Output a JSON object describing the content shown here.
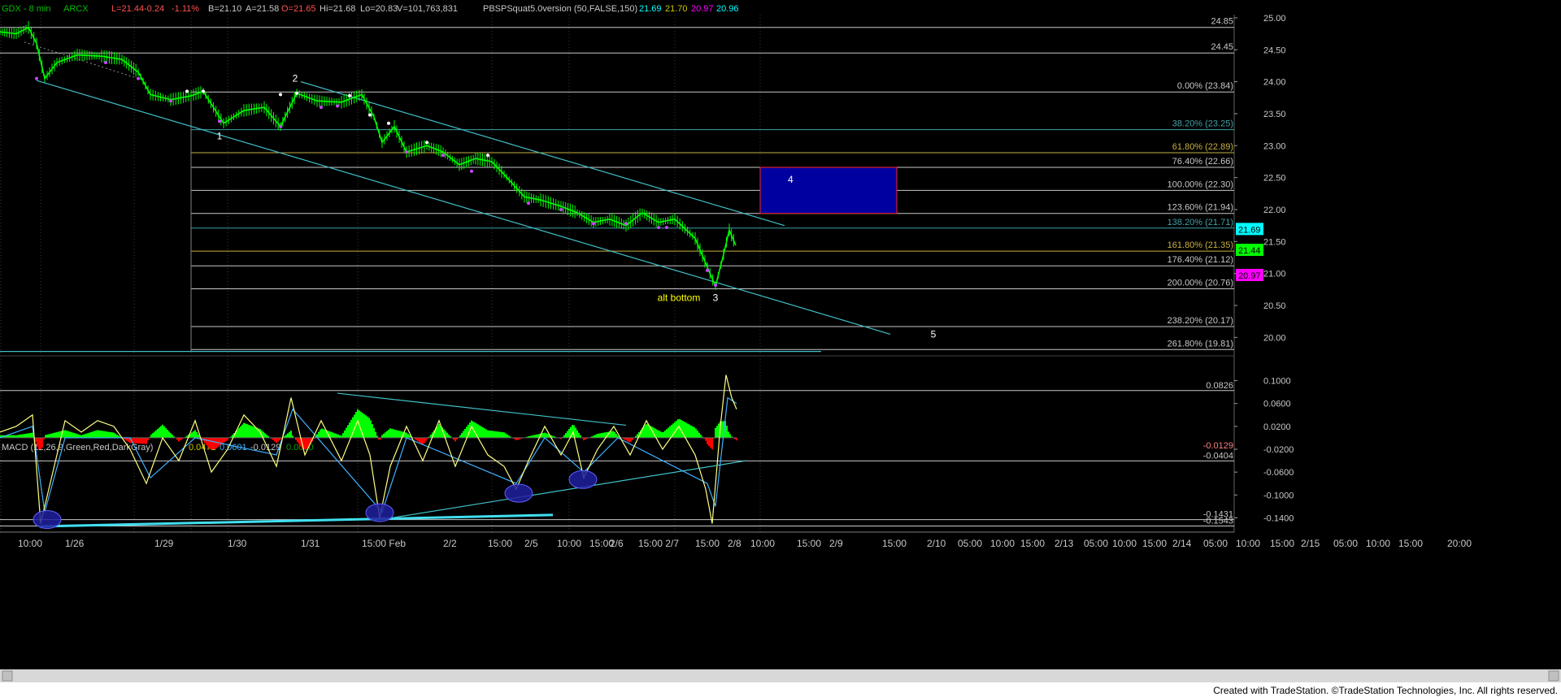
{
  "header": {
    "symbol": "GDX - 8 min",
    "exchange": "ARCX",
    "last": "L=21.44",
    "change": "-0.24",
    "change_pct": "-1.11%",
    "bid": "B=21.10",
    "ask": "A=21.58",
    "open": "O=21.65",
    "high": "Hi=21.68",
    "low": "Lo=20.83",
    "volume": "V=101,763,831",
    "indicator": "PBSPSquat5.0version (50,FALSE,150)",
    "ind_val_1": "21.69",
    "ind_val_2": "21.70",
    "ind_val_3": "20.97",
    "ind_val_4": "20.96"
  },
  "macd_header": {
    "label": "MACD (12,26,9,Green,Red,DarkGray)",
    "v1": "0.0472",
    "v2": "0.0601",
    "v3": "-0.0129",
    "v4": "0.0000"
  },
  "footer": "Created with TradeStation. ©TradeStation Technologies, Inc. All rights reserved.",
  "colors": {
    "background": "#000000",
    "price": "#00ff00",
    "pivot_dots": "#cc44ff",
    "fib_line": "#c8c8c8",
    "channel": "#40c0c8",
    "target_box": "#0000a0",
    "target_border": "#ff2020",
    "macd_hist_pos": "#00ff00",
    "macd_hist_neg": "#ff0000",
    "macd_line": "#ffff80",
    "signal_line": "#40b0ff",
    "ellipse": "#2020a0",
    "price_label_cyan": "#00ffff",
    "price_label_green": "#00ff00",
    "price_label_magenta": "#ff00ff"
  },
  "chart_data": [
    {
      "type": "line",
      "title": "GDX - 8 min",
      "ylim": [
        19.75,
        25.05
      ],
      "y_ticks": [
        "25.00",
        "24.50",
        "24.00",
        "23.50",
        "23.00",
        "22.50",
        "22.00",
        "21.50",
        "21.00",
        "20.50",
        "20.00"
      ],
      "x_tick_labels": [
        "10:00",
        "1/26",
        "1/29",
        "1/30",
        "1/31",
        "15:00 Feb",
        "2/2",
        "15:00",
        "2/5",
        "10:00",
        "15:00",
        "2/6",
        "15:00 2/7",
        "15:00",
        "2/8",
        "10:00",
        "15:00",
        "2/9",
        "15:00",
        "2/10",
        "05:00",
        "10:00",
        "15:00",
        "2/13",
        "05:00",
        "10:00",
        "15:00",
        "2/14",
        "05:00",
        "10:00",
        "15:00",
        "2/15",
        "05:00",
        "10:00",
        "15:00",
        "20:00"
      ],
      "series": [
        {
          "values": [
            {
              "x": 0,
              "y": 24.78
            },
            {
              "x": 20,
              "y": 24.75
            },
            {
              "x": 35,
              "y": 24.85
            },
            {
              "x": 45,
              "y": 24.6
            },
            {
              "x": 55,
              "y": 24.05
            },
            {
              "x": 70,
              "y": 24.3
            },
            {
              "x": 95,
              "y": 24.42
            },
            {
              "x": 125,
              "y": 24.4
            },
            {
              "x": 150,
              "y": 24.35
            },
            {
              "x": 170,
              "y": 24.15
            },
            {
              "x": 185,
              "y": 23.8
            },
            {
              "x": 210,
              "y": 23.72
            },
            {
              "x": 235,
              "y": 23.78
            },
            {
              "x": 250,
              "y": 23.85
            },
            {
              "x": 275,
              "y": 23.35
            },
            {
              "x": 300,
              "y": 23.55
            },
            {
              "x": 325,
              "y": 23.6
            },
            {
              "x": 345,
              "y": 23.3
            },
            {
              "x": 365,
              "y": 23.82
            },
            {
              "x": 390,
              "y": 23.7
            },
            {
              "x": 420,
              "y": 23.68
            },
            {
              "x": 445,
              "y": 23.8
            },
            {
              "x": 460,
              "y": 23.45
            },
            {
              "x": 470,
              "y": 23.05
            },
            {
              "x": 485,
              "y": 23.3
            },
            {
              "x": 500,
              "y": 22.9
            },
            {
              "x": 525,
              "y": 23.0
            },
            {
              "x": 545,
              "y": 22.9
            },
            {
              "x": 565,
              "y": 22.7
            },
            {
              "x": 585,
              "y": 22.8
            },
            {
              "x": 605,
              "y": 22.75
            },
            {
              "x": 620,
              "y": 22.55
            },
            {
              "x": 645,
              "y": 22.2
            },
            {
              "x": 665,
              "y": 22.15
            },
            {
              "x": 690,
              "y": 22.05
            },
            {
              "x": 710,
              "y": 21.95
            },
            {
              "x": 730,
              "y": 21.8
            },
            {
              "x": 750,
              "y": 21.85
            },
            {
              "x": 770,
              "y": 21.75
            },
            {
              "x": 790,
              "y": 21.95
            },
            {
              "x": 810,
              "y": 21.8
            },
            {
              "x": 830,
              "y": 21.85
            },
            {
              "x": 855,
              "y": 21.55
            },
            {
              "x": 870,
              "y": 21.1
            },
            {
              "x": 880,
              "y": 20.8
            },
            {
              "x": 890,
              "y": 21.3
            },
            {
              "x": 897,
              "y": 21.68
            },
            {
              "x": 905,
              "y": 21.44
            }
          ]
        }
      ],
      "fib_levels": [
        {
          "pct": "0.00%",
          "price": 23.84,
          "label": "0.00% (23.84)",
          "color": "#c8c8c8"
        },
        {
          "pct": "38.20%",
          "price": 23.25,
          "label": "38.20% (23.25)",
          "color": "#40a0a8"
        },
        {
          "pct": "61.80%",
          "price": 22.89,
          "label": "61.80% (22.89)",
          "color": "#c8b040"
        },
        {
          "pct": "76.40%",
          "price": 22.66,
          "label": "76.40% (22.66)",
          "color": "#c8c8c8"
        },
        {
          "pct": "100.00%",
          "price": 22.3,
          "label": "100.00% (22.30)",
          "color": "#c8c8c8"
        },
        {
          "pct": "123.60%",
          "price": 21.94,
          "label": "123.60% (21.94)",
          "color": "#c8c8c8"
        },
        {
          "pct": "138.20%",
          "price": 21.71,
          "label": "138.20% (21.71)",
          "color": "#40a0a8"
        },
        {
          "pct": "161.80%",
          "price": 21.35,
          "label": "161.80% (21.35)",
          "color": "#c8b040"
        },
        {
          "pct": "176.40%",
          "price": 21.12,
          "label": "176.40% (21.12)",
          "color": "#c8c8c8"
        },
        {
          "pct": "200.00%",
          "price": 20.76,
          "label": "200.00% (20.76)",
          "color": "#c8c8c8"
        },
        {
          "pct": "238.20%",
          "price": 20.17,
          "label": "238.20% (20.17)",
          "color": "#c8c8c8"
        },
        {
          "pct": "261.80%",
          "price": 19.81,
          "label": "261.80% (19.81)",
          "color": "#c8c8c8"
        }
      ],
      "horizontal_levels": [
        {
          "price": 24.85,
          "label": "24.85"
        },
        {
          "price": 24.45,
          "label": "24.45"
        }
      ],
      "channel_lines": [
        {
          "from": {
            "x": 45,
            "y": 24.02
          },
          "to": {
            "x": 1095,
            "y": 20.05
          }
        },
        {
          "from": {
            "x": 370,
            "y": 24.0
          },
          "to": {
            "x": 965,
            "y": 21.75
          }
        },
        {
          "from": {
            "x": 0,
            "y": 19.78
          },
          "to": {
            "x": 1010,
            "y": 19.78
          }
        }
      ],
      "target_box": {
        "x_start": 935,
        "x_end": 1103,
        "y_top": 22.66,
        "y_bottom": 21.94,
        "label": "4"
      },
      "wave_labels": [
        {
          "text": "1",
          "x": 270,
          "y": 23.1,
          "color": "#ffffff"
        },
        {
          "text": "2",
          "x": 363,
          "y": 24.0,
          "color": "#ffffff"
        },
        {
          "text": "alt bottom",
          "x": 835,
          "y": 20.57,
          "color": "#ffff00"
        },
        {
          "text": "3",
          "x": 880,
          "y": 20.57,
          "color": "#ffffff"
        },
        {
          "text": "5",
          "x": 1148,
          "y": 20.0,
          "color": "#ffffff"
        }
      ],
      "price_labels": [
        {
          "text": "21.69",
          "price": 21.69,
          "color": "#00ffff"
        },
        {
          "text": "21.44",
          "price": 21.44,
          "color": "#00ff00"
        },
        {
          "text": "20.97",
          "price": 20.97,
          "color": "#ff00ff"
        }
      ]
    },
    {
      "type": "bar",
      "title": "MACD (12,26,9,Green,Red,DarkGray)",
      "ylim": [
        -0.155,
        0.115
      ],
      "y_ticks": [
        "0.1000",
        "0.0600",
        "0.0200",
        "-0.0200",
        "-0.0600",
        "-0.1000",
        "-0.1400"
      ],
      "level_lines": [
        {
          "value": 0.0826,
          "label": "0.0826"
        },
        {
          "value": -0.0404,
          "label": "-0.0404"
        },
        {
          "value": -0.1431,
          "label": "-0.1431"
        },
        {
          "value": -0.1543,
          "label": "-0.1543"
        }
      ],
      "current_value_label": "-0.0129",
      "macd_line": [
        {
          "x": 0,
          "y": 0.01
        },
        {
          "x": 20,
          "y": 0.02
        },
        {
          "x": 40,
          "y": 0.04
        },
        {
          "x": 50,
          "y": -0.15
        },
        {
          "x": 65,
          "y": -0.06
        },
        {
          "x": 80,
          "y": 0.03
        },
        {
          "x": 100,
          "y": 0.01
        },
        {
          "x": 120,
          "y": 0.03
        },
        {
          "x": 140,
          "y": 0.02
        },
        {
          "x": 160,
          "y": -0.02
        },
        {
          "x": 180,
          "y": -0.08
        },
        {
          "x": 200,
          "y": 0.0
        },
        {
          "x": 220,
          "y": -0.04
        },
        {
          "x": 240,
          "y": 0.03
        },
        {
          "x": 260,
          "y": -0.06
        },
        {
          "x": 280,
          "y": -0.02
        },
        {
          "x": 300,
          "y": 0.04
        },
        {
          "x": 320,
          "y": 0.01
        },
        {
          "x": 340,
          "y": -0.05
        },
        {
          "x": 358,
          "y": 0.07
        },
        {
          "x": 375,
          "y": -0.03
        },
        {
          "x": 395,
          "y": 0.03
        },
        {
          "x": 420,
          "y": -0.04
        },
        {
          "x": 440,
          "y": 0.03
        },
        {
          "x": 455,
          "y": -0.03
        },
        {
          "x": 467,
          "y": -0.14
        },
        {
          "x": 480,
          "y": -0.05
        },
        {
          "x": 500,
          "y": 0.02
        },
        {
          "x": 520,
          "y": -0.04
        },
        {
          "x": 540,
          "y": 0.03
        },
        {
          "x": 560,
          "y": -0.05
        },
        {
          "x": 580,
          "y": 0.02
        },
        {
          "x": 600,
          "y": -0.03
        },
        {
          "x": 620,
          "y": -0.05
        },
        {
          "x": 635,
          "y": -0.09
        },
        {
          "x": 650,
          "y": -0.04
        },
        {
          "x": 670,
          "y": 0.02
        },
        {
          "x": 690,
          "y": -0.03
        },
        {
          "x": 705,
          "y": 0.01
        },
        {
          "x": 718,
          "y": -0.07
        },
        {
          "x": 735,
          "y": -0.02
        },
        {
          "x": 755,
          "y": 0.02
        },
        {
          "x": 775,
          "y": -0.03
        },
        {
          "x": 795,
          "y": 0.03
        },
        {
          "x": 815,
          "y": -0.02
        },
        {
          "x": 835,
          "y": 0.02
        },
        {
          "x": 855,
          "y": -0.03
        },
        {
          "x": 868,
          "y": -0.09
        },
        {
          "x": 876,
          "y": -0.15
        },
        {
          "x": 886,
          "y": 0.02
        },
        {
          "x": 893,
          "y": 0.11
        },
        {
          "x": 900,
          "y": 0.07
        },
        {
          "x": 906,
          "y": 0.05
        }
      ],
      "signal_line": [
        {
          "x": 0,
          "y": 0.0
        },
        {
          "x": 40,
          "y": 0.02
        },
        {
          "x": 55,
          "y": -0.13
        },
        {
          "x": 80,
          "y": 0.0
        },
        {
          "x": 160,
          "y": 0.0
        },
        {
          "x": 185,
          "y": -0.07
        },
        {
          "x": 240,
          "y": 0.0
        },
        {
          "x": 340,
          "y": -0.03
        },
        {
          "x": 360,
          "y": 0.05
        },
        {
          "x": 470,
          "y": -0.13
        },
        {
          "x": 500,
          "y": 0.0
        },
        {
          "x": 635,
          "y": -0.08
        },
        {
          "x": 670,
          "y": 0.0
        },
        {
          "x": 718,
          "y": -0.06
        },
        {
          "x": 760,
          "y": 0.0
        },
        {
          "x": 870,
          "y": -0.08
        },
        {
          "x": 880,
          "y": -0.12
        },
        {
          "x": 895,
          "y": 0.07
        },
        {
          "x": 906,
          "y": 0.06
        }
      ],
      "histogram_note": "green above zero, red below zero",
      "trend_lines": [
        {
          "from": {
            "x": 50,
            "y": -0.155
          },
          "to": {
            "x": 680,
            "y": -0.135
          }
        },
        {
          "from": {
            "x": 415,
            "y": 0.078
          },
          "to": {
            "x": 770,
            "y": 0.022
          }
        },
        {
          "from": {
            "x": 460,
            "y": -0.145
          },
          "to": {
            "x": 918,
            "y": -0.04
          }
        }
      ],
      "ellipses": [
        {
          "x": 58,
          "y": -0.143
        },
        {
          "x": 467,
          "y": -0.131
        },
        {
          "x": 638,
          "y": -0.097
        },
        {
          "x": 717,
          "y": -0.073
        }
      ]
    }
  ]
}
